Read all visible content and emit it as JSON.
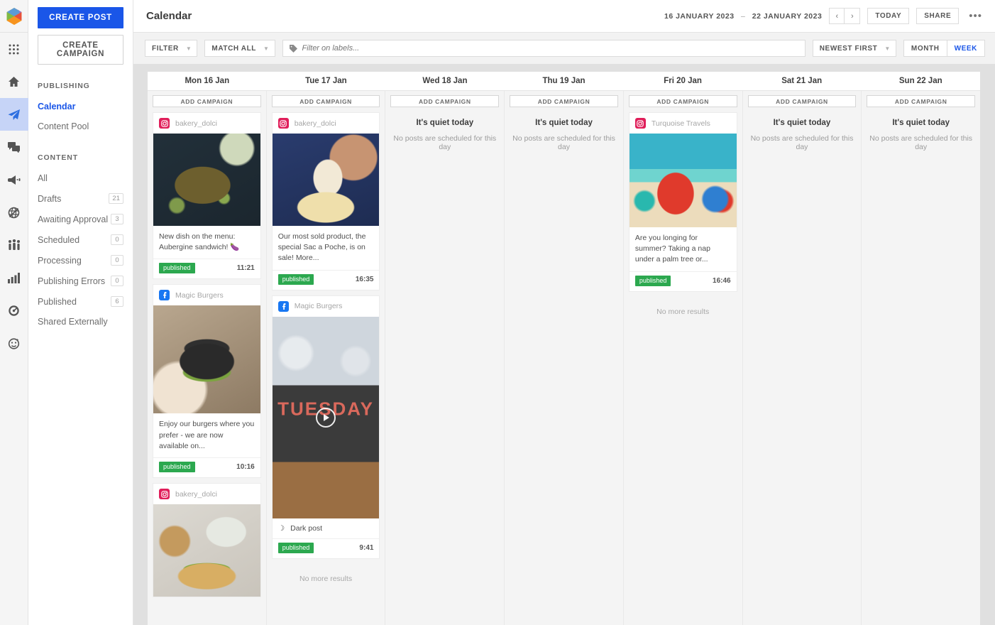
{
  "brand": {
    "logo": "hexagon-logo"
  },
  "rail": {
    "items": [
      {
        "name": "apps-grid-icon"
      },
      {
        "name": "home-icon"
      },
      {
        "name": "publish-paper-plane-icon",
        "active": true
      },
      {
        "name": "conversations-icon"
      },
      {
        "name": "megaphone-icon"
      },
      {
        "name": "globe-listening-icon"
      },
      {
        "name": "audience-people-icon"
      },
      {
        "name": "analytics-bar-chart-icon"
      },
      {
        "name": "dashboard-gauge-icon"
      },
      {
        "name": "profile-avatar-icon"
      }
    ]
  },
  "sidebar": {
    "create_post_label": "CREATE POST",
    "create_campaign_label": "CREATE CAMPAIGN",
    "sections": [
      {
        "title": "PUBLISHING",
        "items": [
          {
            "label": "Calendar",
            "count": "",
            "selected": true
          },
          {
            "label": "Content Pool",
            "count": "",
            "selected": false
          }
        ]
      },
      {
        "title": "CONTENT",
        "items": [
          {
            "label": "All",
            "count": "",
            "selected": false
          },
          {
            "label": "Drafts",
            "count": "21",
            "selected": false
          },
          {
            "label": "Awaiting Approval",
            "count": "3",
            "selected": false
          },
          {
            "label": "Scheduled",
            "count": "0",
            "selected": false
          },
          {
            "label": "Processing",
            "count": "0",
            "selected": false
          },
          {
            "label": "Publishing Errors",
            "count": "0",
            "selected": false
          },
          {
            "label": "Published",
            "count": "6",
            "selected": false
          },
          {
            "label": "Shared Externally",
            "count": "",
            "selected": false
          }
        ]
      }
    ]
  },
  "header": {
    "title": "Calendar",
    "date_from": "16 JANUARY 2023",
    "date_dash": "–",
    "date_to": "22 JANUARY 2023",
    "prev_label": "‹",
    "next_label": "›",
    "today_label": "TODAY",
    "share_label": "SHARE",
    "more_label": "•••"
  },
  "filterbar": {
    "filter_label": "FILTER",
    "match_label": "MATCH ALL",
    "labels_placeholder": "Filter on labels...",
    "labels_value": "",
    "sort_label": "NEWEST FIRST",
    "month_label": "MONTH",
    "week_label": "WEEK",
    "active_view": "WEEK"
  },
  "calendar": {
    "add_campaign_label": "ADD CAMPAIGN",
    "quiet_title": "It's quiet today",
    "quiet_sub": "No posts are scheduled for this day",
    "no_more_label": "No more results",
    "days": [
      {
        "header": "Mon 16 Jan",
        "empty": false,
        "show_no_more": false,
        "posts": [
          {
            "channel": "bakery_dolci",
            "network": "instagram",
            "media": "ph-aubergine",
            "media_h": 130,
            "text": "New dish on the menu: Aubergine sandwich! 🍆",
            "status": "published",
            "time": "11:21",
            "video": false,
            "dark_post": false
          },
          {
            "channel": "Magic Burgers",
            "network": "facebook",
            "media": "ph-burger",
            "media_h": 152,
            "text": "Enjoy our burgers where you prefer - we are now available on...",
            "status": "published",
            "time": "10:16",
            "video": false,
            "dark_post": false
          },
          {
            "channel": "bakery_dolci",
            "network": "instagram",
            "media": "ph-sandwich",
            "media_h": 130,
            "text": "",
            "status": "",
            "time": "",
            "video": false,
            "dark_post": false
          }
        ]
      },
      {
        "header": "Tue 17 Jan",
        "empty": false,
        "show_no_more": true,
        "posts": [
          {
            "channel": "bakery_dolci",
            "network": "instagram",
            "media": "ph-piping",
            "media_h": 130,
            "text": "Our most sold product, the special Sac a Poche, is on sale! More...",
            "status": "published",
            "time": "16:35",
            "video": false,
            "dark_post": false
          },
          {
            "channel": "Magic Burgers",
            "network": "facebook",
            "media": "ph-office",
            "media_h": 284,
            "text": "",
            "status": "published",
            "time": "9:41",
            "video": true,
            "dark_post": true,
            "dark_post_label": "Dark post",
            "media_caption": "TUESDAY"
          }
        ]
      },
      {
        "header": "Wed 18 Jan",
        "empty": true,
        "show_no_more": false,
        "posts": []
      },
      {
        "header": "Thu 19 Jan",
        "empty": true,
        "show_no_more": false,
        "posts": []
      },
      {
        "header": "Fri 20 Jan",
        "empty": false,
        "show_no_more": true,
        "posts": [
          {
            "channel": "Turquoise Travels",
            "network": "instagram",
            "media": "ph-beach",
            "media_h": 132,
            "text": "Are you longing for summer? Taking a nap under a palm tree or...",
            "status": "published",
            "time": "16:46",
            "video": false,
            "dark_post": false
          }
        ]
      },
      {
        "header": "Sat 21 Jan",
        "empty": true,
        "show_no_more": false,
        "posts": []
      },
      {
        "header": "Sun 22 Jan",
        "empty": true,
        "show_no_more": false,
        "posts": []
      }
    ]
  },
  "colors": {
    "accent": "#1a56e8",
    "published": "#2ca84f",
    "instagram": "#e01e5a",
    "facebook": "#1877f2"
  }
}
